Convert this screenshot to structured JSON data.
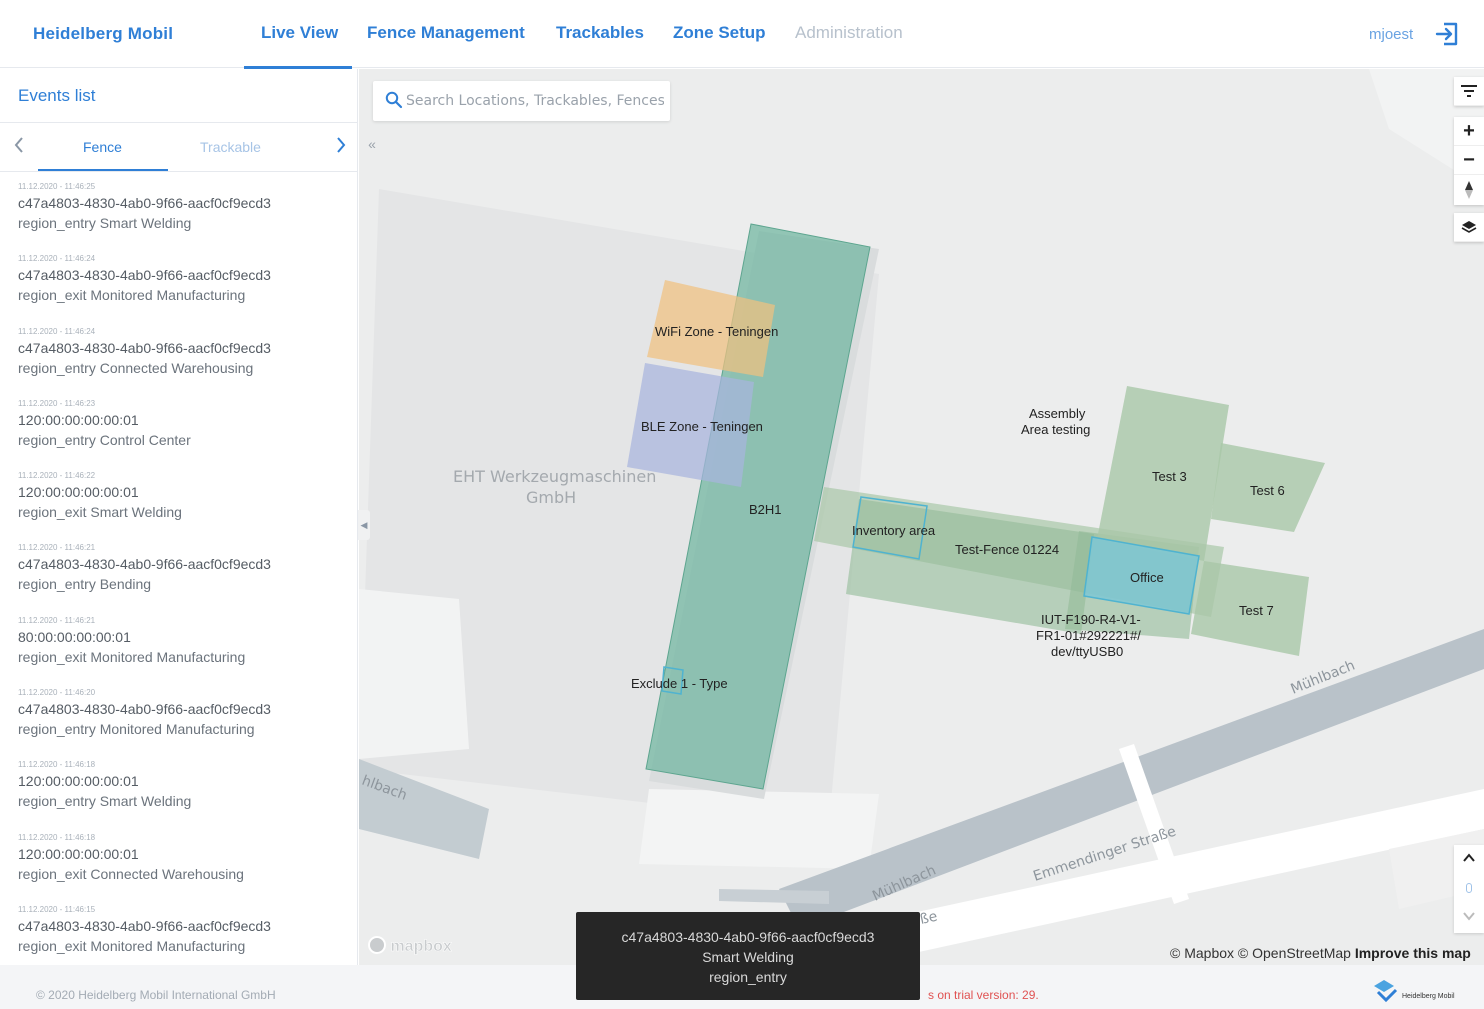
{
  "brand": "Heidelberg Mobil",
  "nav": [
    {
      "label": "Live View"
    },
    {
      "label": "Fence Management"
    },
    {
      "label": "Trackables"
    },
    {
      "label": "Zone Setup"
    },
    {
      "label": "Administration"
    }
  ],
  "user": "mjoest",
  "sidebar": {
    "title": "Events list",
    "tabs": [
      "Fence",
      "Trackable"
    ],
    "events": [
      {
        "ts": "11.12.2020 - 11:46:25",
        "id": "c47a4803-4830-4ab0-9f66-aacf0cf9ecd3",
        "desc": "region_entry Smart Welding"
      },
      {
        "ts": "11.12.2020 - 11:46:24",
        "id": "c47a4803-4830-4ab0-9f66-aacf0cf9ecd3",
        "desc": "region_exit Monitored Manufacturing"
      },
      {
        "ts": "11.12.2020 - 11:46:24",
        "id": "c47a4803-4830-4ab0-9f66-aacf0cf9ecd3",
        "desc": "region_entry Connected Warehousing"
      },
      {
        "ts": "11.12.2020 - 11:46:23",
        "id": "120:00:00:00:00:01",
        "desc": "region_entry Control Center"
      },
      {
        "ts": "11.12.2020 - 11:46:22",
        "id": "120:00:00:00:00:01",
        "desc": "region_exit Smart Welding"
      },
      {
        "ts": "11.12.2020 - 11:46:21",
        "id": "c47a4803-4830-4ab0-9f66-aacf0cf9ecd3",
        "desc": "region_entry Bending"
      },
      {
        "ts": "11.12.2020 - 11:46:21",
        "id": "80:00:00:00:00:01",
        "desc": "region_exit Monitored Manufacturing"
      },
      {
        "ts": "11.12.2020 - 11:46:20",
        "id": "c47a4803-4830-4ab0-9f66-aacf0cf9ecd3",
        "desc": "region_entry Monitored Manufacturing"
      },
      {
        "ts": "11.12.2020 - 11:46:18",
        "id": "120:00:00:00:00:01",
        "desc": "region_entry Smart Welding"
      },
      {
        "ts": "11.12.2020 - 11:46:18",
        "id": "120:00:00:00:00:01",
        "desc": "region_exit Connected Warehousing"
      },
      {
        "ts": "11.12.2020 - 11:46:15",
        "id": "c47a4803-4830-4ab0-9f66-aacf0cf9ecd3",
        "desc": "region_exit Monitored Manufacturing"
      }
    ]
  },
  "search": {
    "placeholder": "Search Locations, Trackables, Fences"
  },
  "map": {
    "building_label": [
      "EHT Werkzeugmaschinen",
      "GmbH"
    ],
    "zones": {
      "wifi": "WiFi Zone - Teningen",
      "ble": "BLE Zone - Teningen",
      "b2h1": "B2H1",
      "inventory": "Inventory area",
      "test_fence": "Test-Fence 01224",
      "office": "Office",
      "assembly": [
        "Assembly",
        "Area testing"
      ],
      "test3": "Test 3",
      "test6": "Test 6",
      "test7": "Test 7",
      "iut": [
        "IUT-F190-R4-V1-",
        "FR1-01#292221#/",
        "dev/ttyUSB0"
      ],
      "exclude": "Exclude 1 - Type"
    },
    "streets": {
      "muhlbach_right": "Mühlbach",
      "muhlbach_bottom": "Mühlbach",
      "muhlbach_left": "hlbach",
      "emmendinger": "Emmendinger Straße",
      "strasse_fragment": "ße"
    },
    "zone_colors": {
      "main": "#6fb5a0",
      "wifi": "#f0c080",
      "ble": "#a7b4de",
      "green": "#a9c7a8",
      "office": "#7ec7d3"
    }
  },
  "mapbox_logo": "mapbox",
  "attribution": {
    "mapbox": "© Mapbox",
    "osm": "© OpenStreetMap",
    "improve": "Improve this map"
  },
  "toast": [
    "c47a4803-4830-4ab0-9f66-aacf0cf9ecd3",
    "Smart Welding",
    "region_entry"
  ],
  "footer": {
    "copyright": "© 2020 Heidelberg Mobil International GmbH",
    "trial": "s on trial version: 29."
  },
  "footer_logo_text": "Heidelberg Mobil"
}
